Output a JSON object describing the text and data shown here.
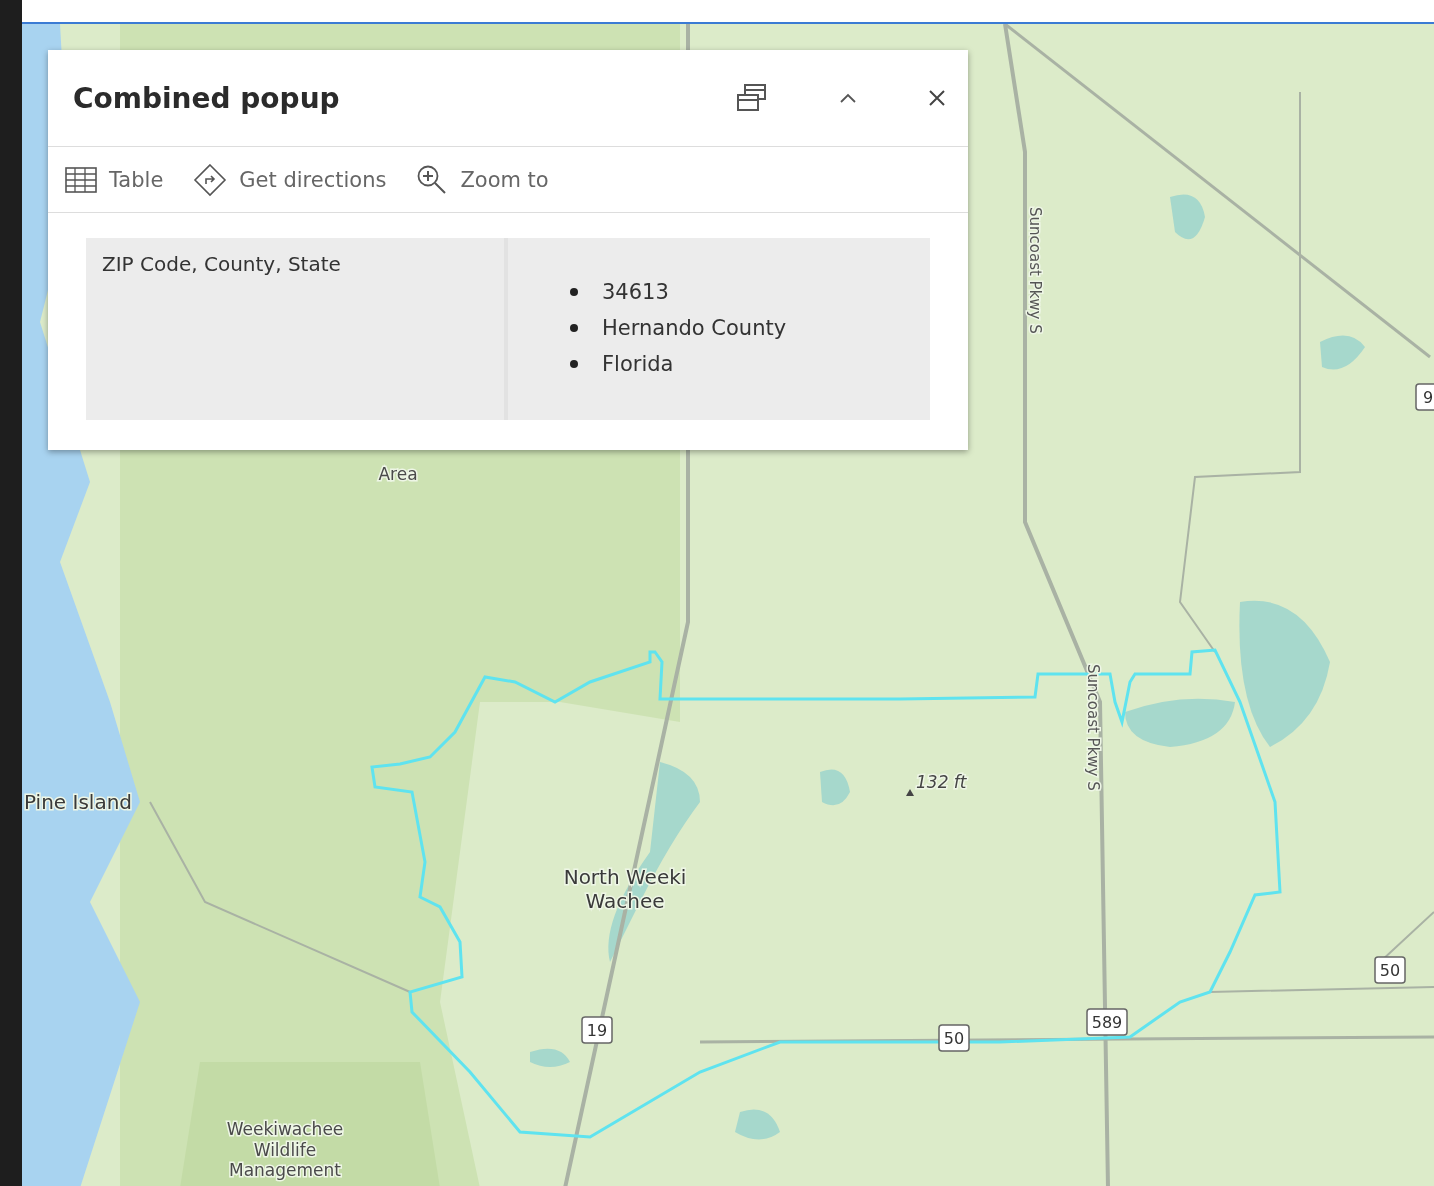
{
  "popup": {
    "title": "Combined popup",
    "header_buttons": [
      {
        "kind": "dock"
      },
      {
        "kind": "collapse"
      },
      {
        "kind": "close"
      }
    ],
    "actions": [
      {
        "kind": "table",
        "label": "Table"
      },
      {
        "kind": "directions",
        "label": "Get directions"
      },
      {
        "kind": "zoom",
        "label": "Zoom to"
      }
    ],
    "fields": [
      {
        "label": "ZIP Code, County, State",
        "values": [
          "34613",
          "Hernando County",
          "Florida"
        ]
      }
    ]
  },
  "map": {
    "labels": [
      {
        "kind": "area",
        "lines": [
          "Area"
        ]
      },
      {
        "kind": "road",
        "lines": [
          "Suncoast Pkwy S"
        ]
      },
      {
        "kind": "road",
        "lines": [
          "Suncoast Pkwy S"
        ]
      },
      {
        "kind": "place",
        "lines": [
          "Pine Island"
        ]
      },
      {
        "kind": "place",
        "lines": [
          "North Weeki",
          "Wachee"
        ]
      },
      {
        "kind": "spot",
        "lines": [
          "132 ft"
        ]
      },
      {
        "kind": "shield",
        "lines": [
          "19"
        ]
      },
      {
        "kind": "shield",
        "lines": [
          "50"
        ]
      },
      {
        "kind": "shield",
        "lines": [
          "589"
        ]
      },
      {
        "kind": "shield",
        "lines": [
          "50"
        ]
      },
      {
        "kind": "shield",
        "lines": [
          "9"
        ]
      },
      {
        "kind": "area",
        "lines": [
          "Weekiwachee",
          "Wildlife",
          "Management"
        ]
      }
    ]
  }
}
